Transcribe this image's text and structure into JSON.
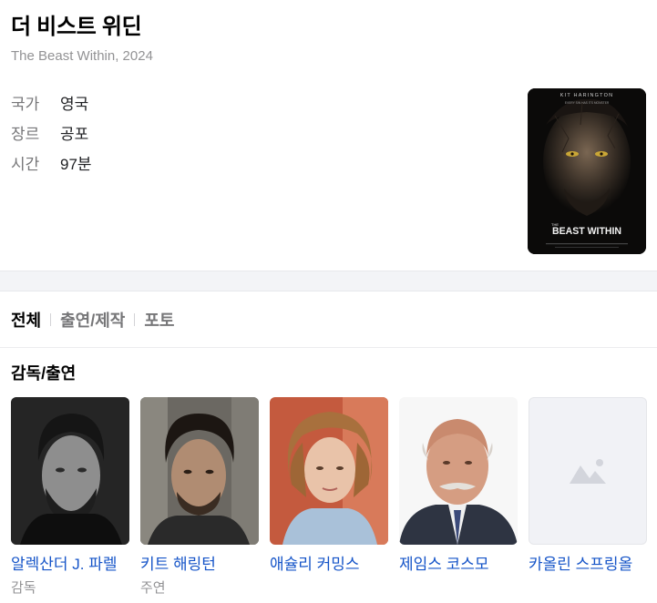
{
  "movie": {
    "title": "더 비스트 위딘",
    "subtitle": "The Beast Within, 2024"
  },
  "info": [
    {
      "key": "국가",
      "value": "영국"
    },
    {
      "key": "장르",
      "value": "공포"
    },
    {
      "key": "시간",
      "value": "97분"
    }
  ],
  "poster": {
    "top_text": "KIT HARINGTON",
    "tagline": "EVERY SIN HAS ITS MONSTER",
    "the": "THE",
    "title_text": "BEAST WITHIN"
  },
  "tabs": [
    "전체",
    "출연/제작",
    "포토"
  ],
  "active_tab": "전체",
  "section": {
    "title": "감독/출연"
  },
  "cast": [
    {
      "name": "알렉산더 J. 파렐",
      "role": "감독"
    },
    {
      "name": "키트 해링턴",
      "role": "주연"
    },
    {
      "name": "애슐리 커밍스",
      "role": ""
    },
    {
      "name": "제임스 코스모",
      "role": ""
    },
    {
      "name": "카올린 스프링올",
      "role": ""
    }
  ],
  "colors": {
    "link": "#1554c8",
    "muted": "#929294",
    "band": "#f3f4f7"
  }
}
